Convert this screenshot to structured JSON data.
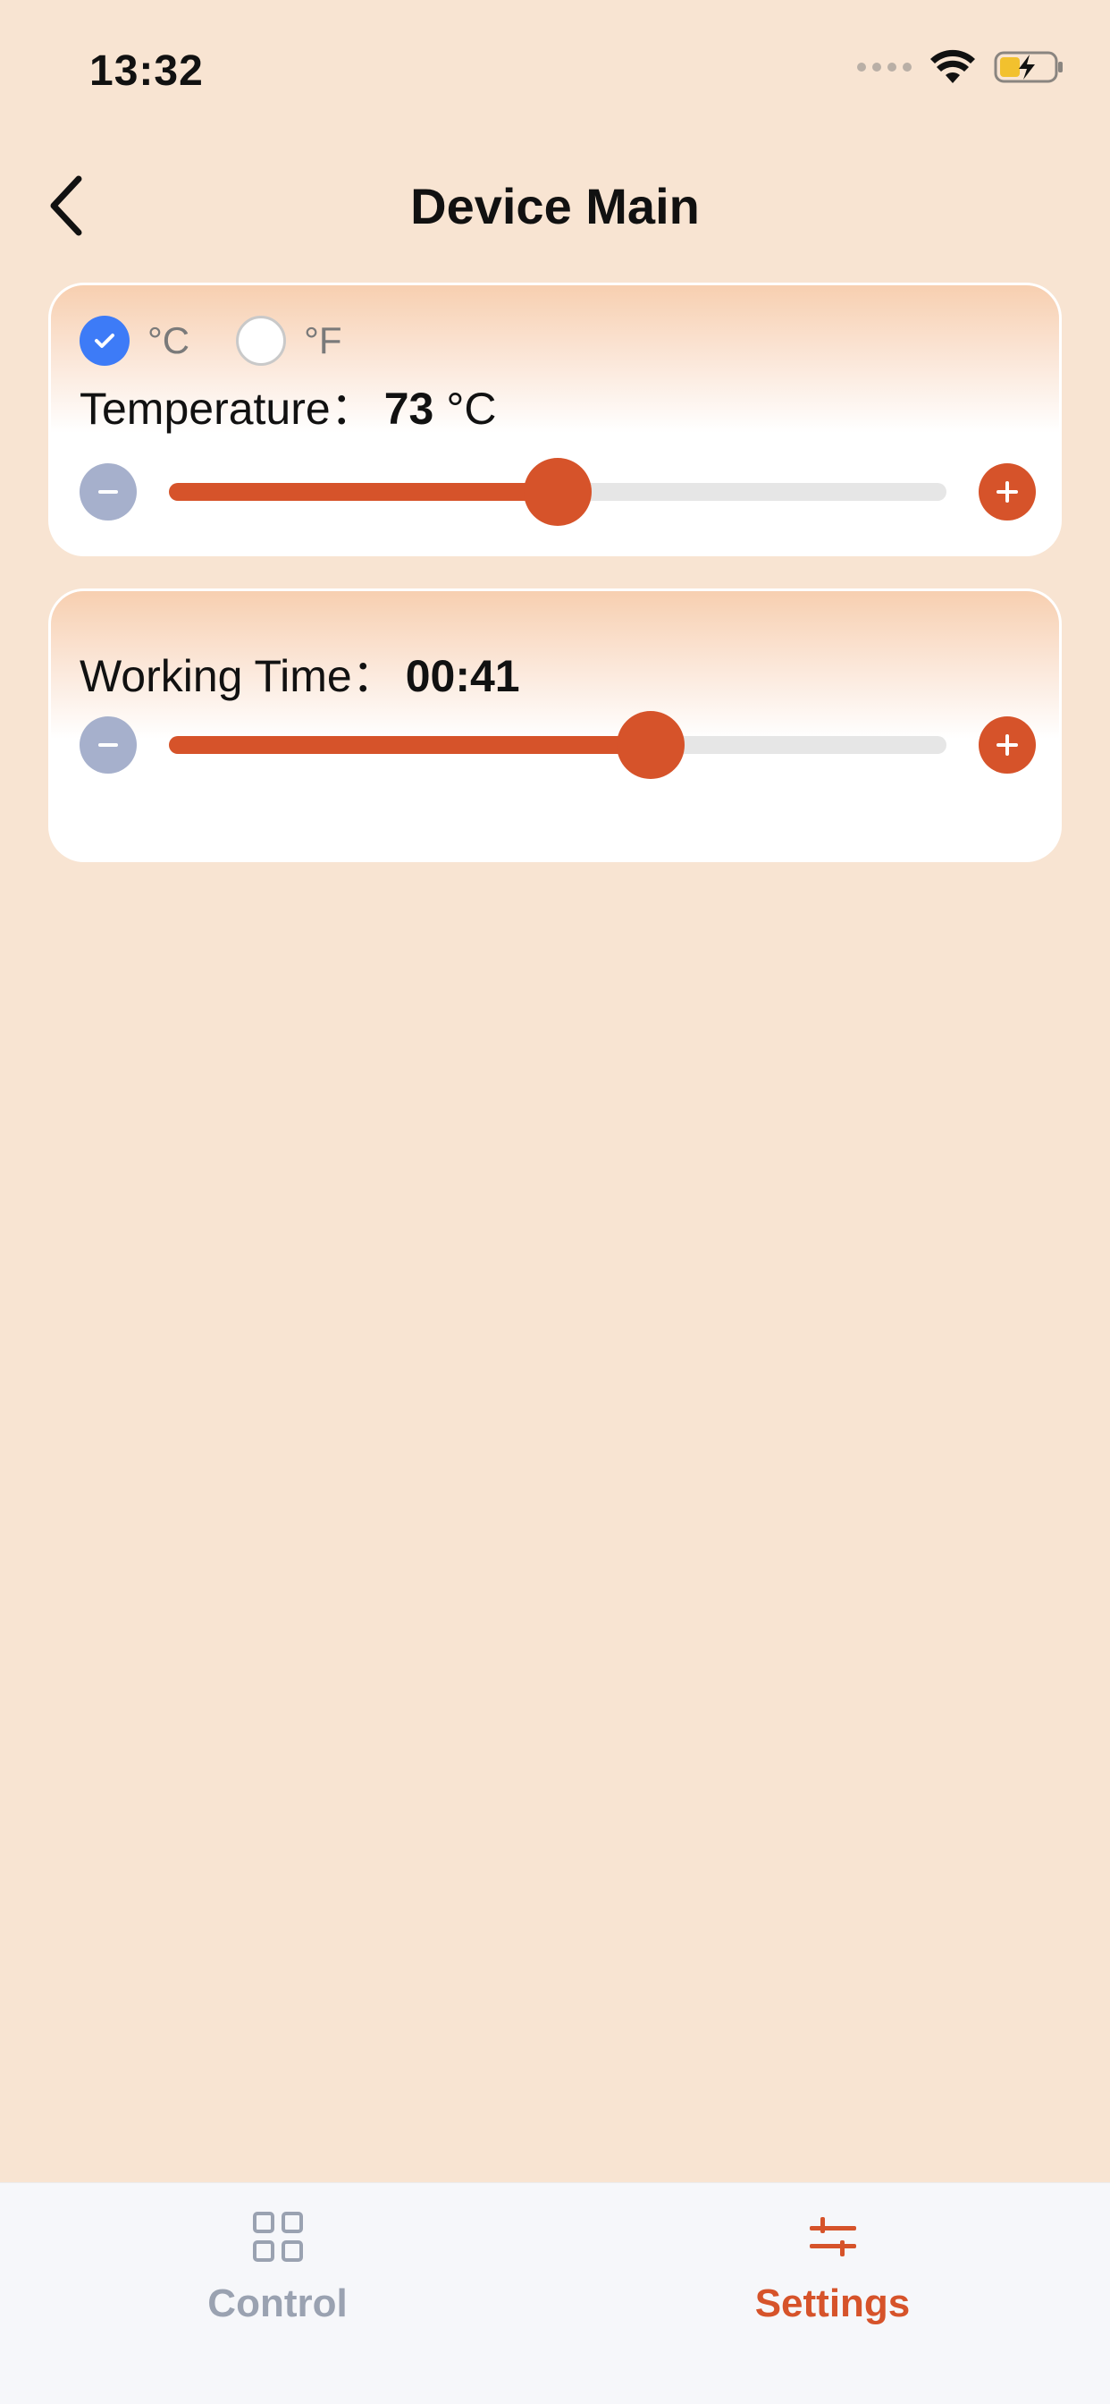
{
  "status_bar": {
    "time": "13:32",
    "icons": [
      "cellular-signal-icon",
      "wifi-icon",
      "battery-charging-icon"
    ]
  },
  "header": {
    "title": "Device Main",
    "back_icon": "chevron-left-icon"
  },
  "temperature_card": {
    "units": [
      {
        "label": "°C",
        "selected": true
      },
      {
        "label": "°F",
        "selected": false
      }
    ],
    "label": "Temperature：",
    "value": "73",
    "unit": "°C",
    "slider_fraction": 0.5
  },
  "working_time_card": {
    "label": "Working Time：",
    "value": "00:41",
    "slider_fraction": 0.62
  },
  "tab_bar": {
    "tabs": [
      {
        "label": "Control",
        "icon": "grid-icon",
        "active": false
      },
      {
        "label": "Settings",
        "icon": "sliders-icon",
        "active": true
      }
    ]
  },
  "colors": {
    "background": "#F8E4D2",
    "accent": "#D6532A",
    "radio_checked": "#3D7BF7",
    "minus_button": "#A6B0CC",
    "inactive_tab": "#9AA2B1"
  }
}
